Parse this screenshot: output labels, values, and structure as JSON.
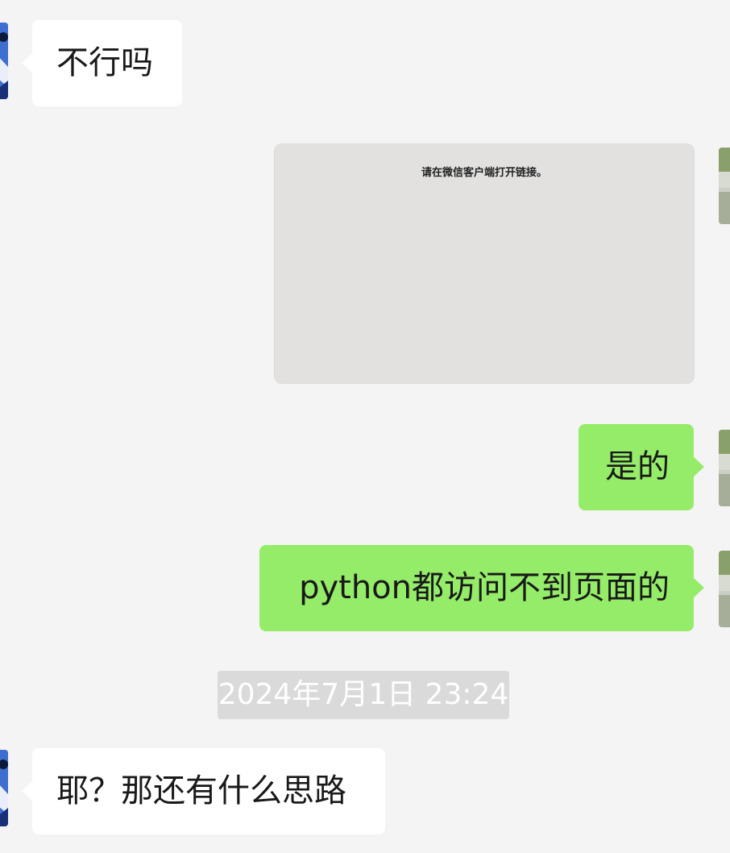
{
  "chat": {
    "messages": [
      {
        "direction": "incoming",
        "text": "不行吗"
      },
      {
        "direction": "outgoing",
        "type": "link-card",
        "notice": "请在微信客户端打开链接。"
      },
      {
        "direction": "outgoing",
        "text": "是的"
      },
      {
        "direction": "outgoing",
        "text": "python都访问不到页面的"
      },
      {
        "direction": "incoming",
        "text": "耶？那还有什么思路"
      }
    ],
    "timestamp": "2024年7月1日 23:24"
  },
  "colors": {
    "background": "#f4f4f4",
    "incoming_bubble": "#ffffff",
    "outgoing_bubble": "#95ec69",
    "link_card": "#e2e1df",
    "timestamp_badge": "#dadada"
  },
  "icons": {
    "contact_avatar": "contact-avatar-icon",
    "self_avatar": "self-avatar-icon"
  }
}
